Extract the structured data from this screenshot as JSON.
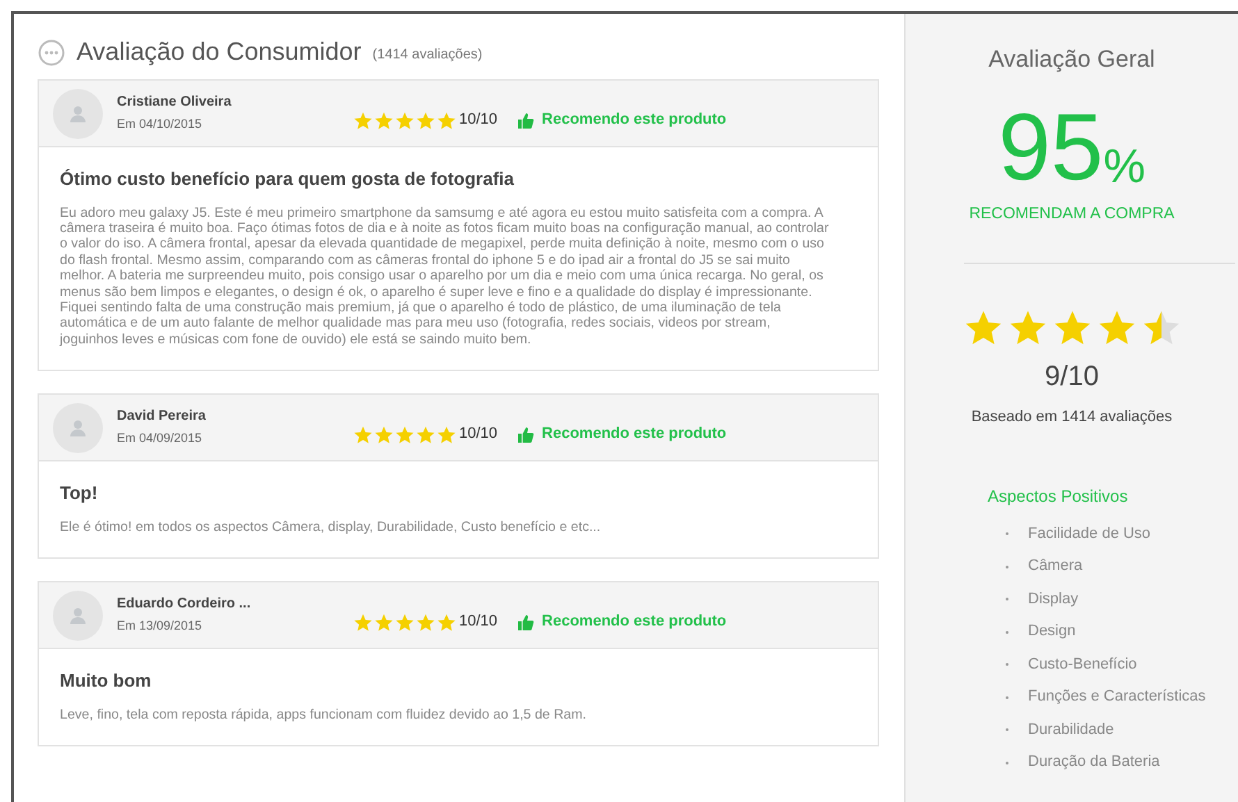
{
  "reviews_section": {
    "title": "Avaliação do Consumidor",
    "count": "(1414 avaliações)",
    "reviews": [
      {
        "name": "Cristiane Oliveira",
        "date": "Em 04/10/2015",
        "stars": 5,
        "score": "10/10",
        "recommend": "Recomendo este produto",
        "title": "Ótimo custo benefício para quem gosta de fotografia",
        "text": "Eu adoro meu galaxy J5. Este é meu primeiro smartphone da samsumg e até agora eu estou muito satisfeita com a compra. A câmera traseira é muito boa. Faço ótimas fotos de dia e à noite as fotos ficam muito boas na configuração manual, ao controlar o valor do iso. A câmera frontal, apesar da elevada quantidade de megapixel, perde muita definição à noite, mesmo com o uso do flash frontal. Mesmo assim, comparando com as câmeras frontal do iphone 5 e do ipad air a frontal do J5 se sai muito melhor. A bateria me surpreendeu muito, pois consigo usar o aparelho por um dia e meio com uma única recarga. No geral, os menus são bem limpos e elegantes, o design é ok, o aparelho é super leve e fino e a qualidade do display é impressionante. Fiquei sentindo falta de uma construção mais premium, já que o aparelho é todo de plástico, de uma iluminação de tela automática e de um auto falante de melhor qualidade mas para meu uso (fotografia, redes sociais, videos por stream, joguinhos leves e músicas com fone de ouvido) ele está se saindo muito bem."
      },
      {
        "name": "David Pereira",
        "date": "Em 04/09/2015",
        "stars": 5,
        "score": "10/10",
        "recommend": "Recomendo este produto",
        "title": "Top!",
        "text": "Ele é ótimo! em todos os aspectos Câmera, display, Durabilidade, Custo benefício e etc..."
      },
      {
        "name": "Eduardo Cordeiro ...",
        "date": "Em 13/09/2015",
        "stars": 5,
        "score": "10/10",
        "recommend": "Recomendo este produto",
        "title": "Muito bom",
        "text": "Leve, fino, tela com reposta rápida, apps funcionam com fluidez devido ao 1,5 de Ram."
      }
    ]
  },
  "overall": {
    "title": "Avaliação Geral",
    "percent": "95",
    "percent_sign": "%",
    "recommend_label": "RECOMENDAM A COMPRA",
    "stars": 4.5,
    "score": "9/10",
    "based_on": "Baseado em 1414 avaliações",
    "positives_title": "Aspectos Positivos",
    "positives": [
      "Facilidade de Uso",
      "Câmera",
      "Display",
      "Design",
      "Custo-Benefício",
      "Funções e Características",
      "Durabilidade",
      "Duração da Bateria"
    ]
  }
}
